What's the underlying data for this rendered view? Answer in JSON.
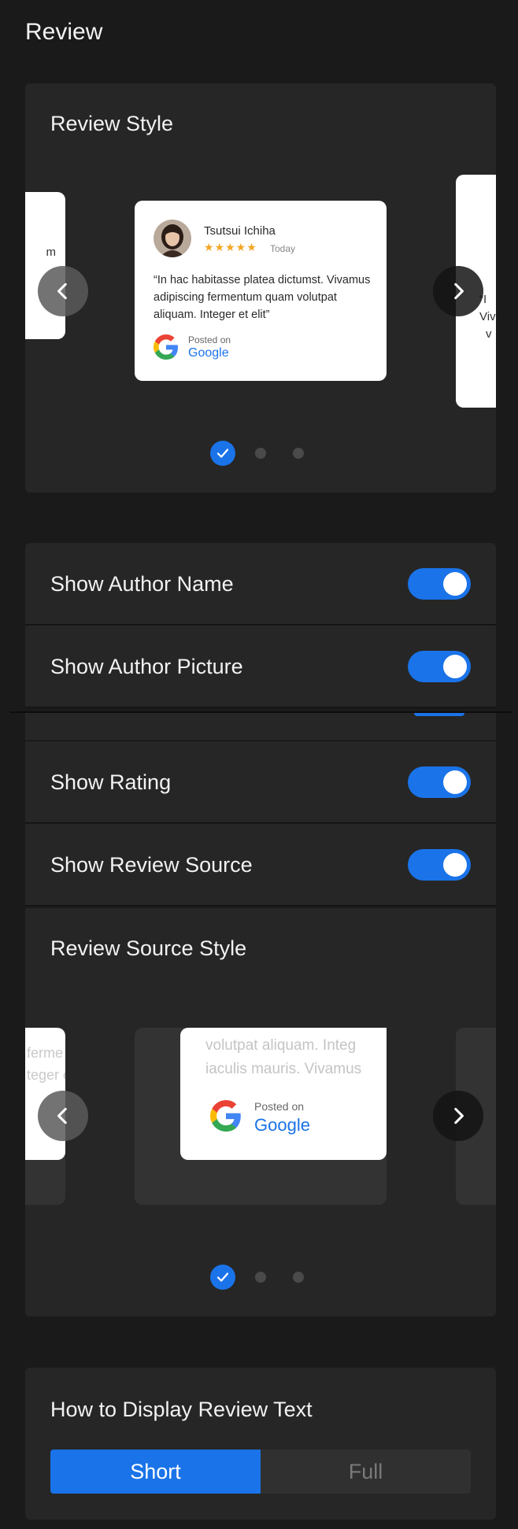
{
  "page": {
    "title": "Review"
  },
  "review_style": {
    "title": "Review Style",
    "left_peek_text": "m",
    "right_peek_lines": [
      "“I",
      "Viv",
      "v"
    ],
    "card": {
      "author_name": "Tsutsui Ichiha",
      "stars": "★★★★★",
      "date": "Today",
      "text": "“In hac habitasse platea dictumst. Vivamus adipiscing fermentum quam volutpat aliquam. Integer et elit”",
      "posted_on": "Posted on",
      "source": "Google"
    },
    "nav": {
      "prev_icon": "chevron-left-icon",
      "next_icon": "chevron-right-icon"
    },
    "pagination": {
      "count": 3,
      "active_index": 0
    }
  },
  "toggles": [
    {
      "label": "Show Author Name",
      "on": true
    },
    {
      "label": "Show Author Picture",
      "on": true
    },
    {
      "label": "Show Rating",
      "on": true
    },
    {
      "label": "Show Review Source",
      "on": true
    }
  ],
  "review_source_style": {
    "title": "Review Source Style",
    "left_peek_lines": [
      "ferme",
      "teger e"
    ],
    "card": {
      "faded_lines": [
        "volutpat aliquam. Integ",
        "iaculis mauris. Vivamus"
      ],
      "posted_on": "Posted on",
      "source": "Google"
    },
    "pagination": {
      "count": 3,
      "active_index": 0
    }
  },
  "display_review_text": {
    "title": "How to Display Review Text",
    "options": [
      "Short",
      "Full"
    ],
    "selected": "Short"
  },
  "colors": {
    "accent": "#1a73e8",
    "panel": "#262626",
    "background": "#1a1a1a",
    "star": "#f5a623"
  }
}
